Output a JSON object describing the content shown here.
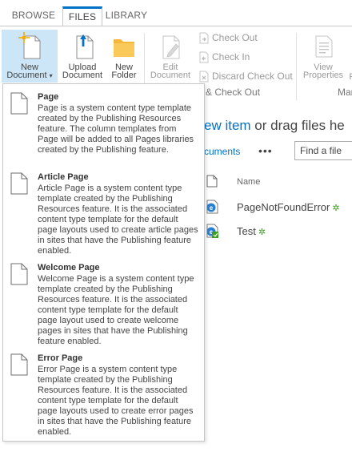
{
  "ribbon": {
    "tabs": [
      {
        "label": "BROWSE"
      },
      {
        "label": "FILES"
      },
      {
        "label": "LIBRARY"
      }
    ],
    "new_document": {
      "line1": "New",
      "line2": "Document"
    },
    "upload_document": {
      "line1": "Upload",
      "line2": "Document"
    },
    "new_folder": {
      "line1": "New",
      "line2": "Folder"
    },
    "edit_document": {
      "line1": "Edit",
      "line2": "Document"
    },
    "check_out": "Check Out",
    "check_in": "Check In",
    "discard_check_out": "Discard Check Out",
    "group_open_checkout": "& Check Out",
    "view_properties": {
      "line1": "View",
      "line2": "Properties"
    },
    "partial_right_1": "P",
    "partial_right_2": "Mar"
  },
  "main": {
    "new_item_link": "ew item",
    "new_item_rest": " or drag files he",
    "documents_link": "cuments",
    "more": "•••",
    "find_placeholder": "Find a file",
    "col_name": "Name",
    "files": [
      {
        "name": "PageNotFoundError",
        "new_mark": "✲"
      },
      {
        "name": "Test",
        "new_mark": "✲"
      }
    ]
  },
  "menu": {
    "items": [
      {
        "title": "Page",
        "desc": "Page is a system content type template created by the Publishing Resources feature. The column templates from Page will be added to all Pages libraries created by the Publishing feature."
      },
      {
        "title": "Article Page",
        "desc": "Article Page is a system content type template created by the Publishing Resources feature. It is the associated content type template for the default page layouts used to create article pages in sites that have the Publishing feature enabled."
      },
      {
        "title": "Welcome Page",
        "desc": "Welcome Page is a system content type template created by the Publishing Resources feature. It is the associated content type template for the default page layout used to create welcome pages in sites that have the Publishing feature enabled."
      },
      {
        "title": "Error Page",
        "desc": "Error Page is a system content type template created by the Publishing Resources feature. It is the associated content type template for the default page layouts used to create error pages in sites that have the Publishing feature enabled."
      }
    ]
  },
  "colors": {
    "accent": "#0072c6",
    "selected_button_bg": "#cde6f7",
    "new_mark": "#3a9e1f"
  }
}
